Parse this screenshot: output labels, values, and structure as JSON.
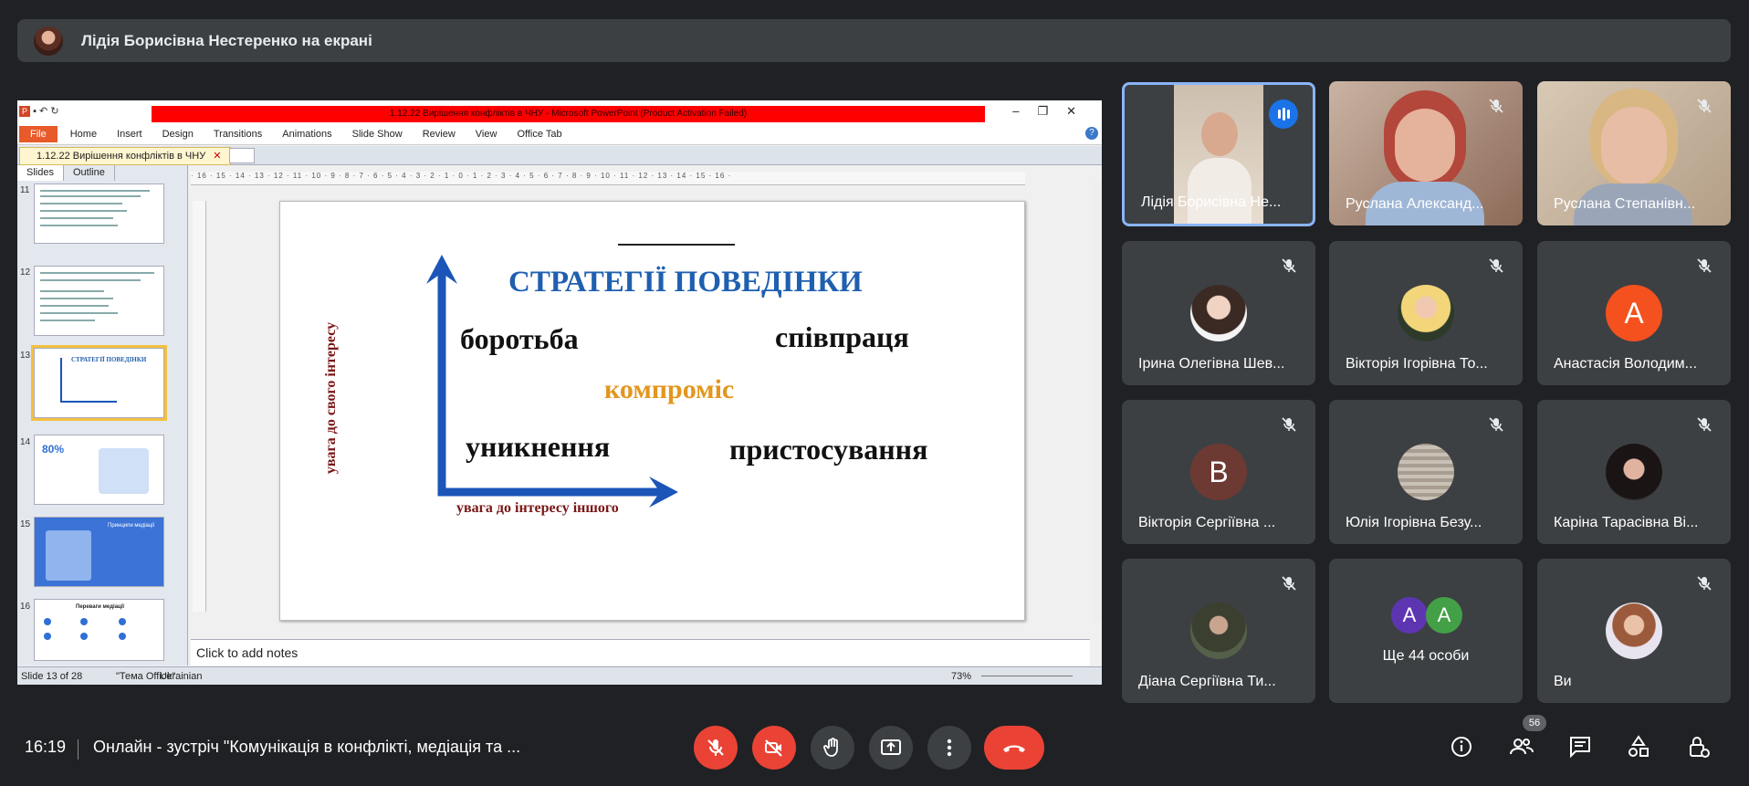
{
  "presenter_bar": {
    "title": "Лідія Борисівна Нестеренко на екрані"
  },
  "ppt": {
    "window_title": "1.12.22 Вирішення конфліктів в ЧНУ - Microsoft PowerPoint (Product Activation Failed)",
    "ribbon_tabs": [
      "File",
      "Home",
      "Insert",
      "Design",
      "Transitions",
      "Animations",
      "Slide Show",
      "Review",
      "View",
      "Office Tab"
    ],
    "doc_tab": "1.12.22 Вирішення конфліктів в ЧНУ",
    "panel_tabs": [
      "Slides",
      "Outline"
    ],
    "slide_numbers": [
      "11",
      "12",
      "13",
      "14",
      "15",
      "16"
    ],
    "thumb_texts": {
      "t13_title": "СТРАТЕГІЇ ПОВЕДІНКИ",
      "t14_big": "80%",
      "t15_title": "Принципи медіації",
      "t16_title": "Переваги медіації"
    },
    "slide": {
      "title": "СТРАТЕГІЇ ПОВЕДІНКИ",
      "top_left": "боротьба",
      "top_right": "співпраця",
      "center": "компроміс",
      "bottom_left": "уникнення",
      "bottom_right": "пристосування",
      "y_axis": "увага до свого інтересу",
      "x_axis": "увага до інтересу іншого"
    },
    "notes_placeholder": "Click to add notes",
    "status": {
      "slide": "Slide 13 of 28",
      "theme": "\"Тема Office\"",
      "lang": "Ukrainian",
      "zoom": "73%"
    },
    "colors": {
      "title_blue": "#1f5fb0",
      "center_orange": "#e3961e",
      "axis_red": "#7a1515",
      "arrow_blue": "#1c55b8"
    }
  },
  "participants": [
    {
      "name": "Лідія Борисівна Не...",
      "speaking": true
    },
    {
      "name": "Руслана Александ...",
      "muted": true
    },
    {
      "name": "Руслана Степанівн...",
      "muted": true
    },
    {
      "name": "Ірина Олегівна Шев...",
      "muted": true
    },
    {
      "name": "Вікторія Ігорівна То...",
      "muted": true
    },
    {
      "name": "Анастасія Володим...",
      "muted": true,
      "letter": "A",
      "color": "#f4511e"
    },
    {
      "name": "Вікторія Сергіївна ...",
      "muted": true,
      "letter": "B",
      "color": "#6d3a33"
    },
    {
      "name": "Юлія Ігорівна Безу...",
      "muted": true
    },
    {
      "name": "Каріна Тарасівна Ві...",
      "muted": true
    },
    {
      "name": "Діана Сергіївна Ти...",
      "muted": true
    },
    {
      "name": "Ще 44 особи",
      "letters": [
        "A",
        "A"
      ],
      "letter_colors": [
        "#5e35b1",
        "#43a047"
      ]
    },
    {
      "name": "Ви",
      "muted": true
    }
  ],
  "bottom": {
    "time": "16:19",
    "meeting": "Онлайн - зустріч \"Комунікація в конфлікті, медіація та ...",
    "people_count": "56"
  }
}
